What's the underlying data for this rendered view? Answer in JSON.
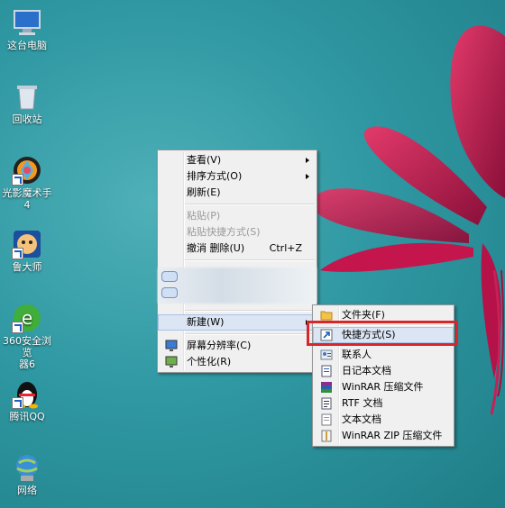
{
  "desktop": {
    "icons": [
      {
        "label": "这台电脑"
      },
      {
        "label": "回收站"
      },
      {
        "label": "光影魔术手4"
      },
      {
        "label": "鲁大师"
      },
      {
        "label": "360安全浏览\n器6"
      },
      {
        "label": "腾讯QQ"
      },
      {
        "label": "网络"
      }
    ]
  },
  "context_menu": {
    "items": {
      "view": "查看(V)",
      "sort": "排序方式(O)",
      "refresh": "刷新(E)",
      "paste": "粘贴(P)",
      "paste_shortcut": "粘贴快捷方式(S)",
      "undo": "撤消 删除(U)",
      "undo_shortcut": "Ctrl+Z",
      "new": "新建(W)",
      "resolution": "屏幕分辨率(C)",
      "personalize": "个性化(R)"
    }
  },
  "submenu": {
    "items": {
      "folder": "文件夹(F)",
      "shortcut": "快捷方式(S)",
      "contact": "联系人",
      "journal": "日记本文档",
      "winrar": "WinRAR 压缩文件",
      "rtf": "RTF 文档",
      "text": "文本文档",
      "winrar_zip": "WinRAR ZIP 压缩文件"
    }
  },
  "colors": {
    "highlight_border": "#d8262b",
    "menu_hover": "#dbe5f3",
    "desktop_bg": "#2f98a2"
  }
}
